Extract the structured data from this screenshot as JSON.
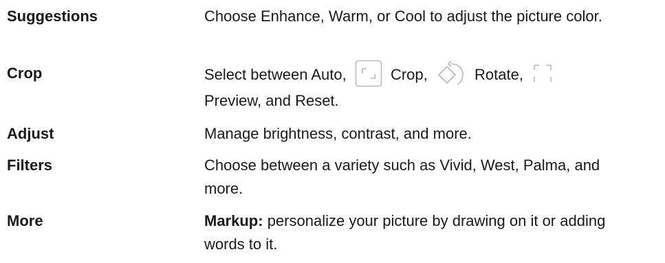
{
  "rows": [
    {
      "term": "Suggestions",
      "description": "Choose Enhance, Warm, or Cool to adjust the picture color."
    },
    {
      "term": "Crop",
      "description_parts": {
        "p1": "Select between Auto,",
        "p2": "Crop,",
        "p3": "Rotate,",
        "p4": "Preview, and Reset."
      },
      "icons": [
        "crop-icon",
        "rotate-icon",
        "preview-icon"
      ]
    },
    {
      "term": "Adjust",
      "description": "Manage brightness, contrast, and more."
    },
    {
      "term": "Filters",
      "description": "Choose between a variety such as Vivid, West, Palma, and more."
    },
    {
      "term": "More",
      "description_bold": "Markup:",
      "description_rest": "personalize your picture by drawing on it or adding words to it."
    }
  ],
  "colors": {
    "text": "#1a1a1a",
    "icon": "#b8b8b8"
  }
}
